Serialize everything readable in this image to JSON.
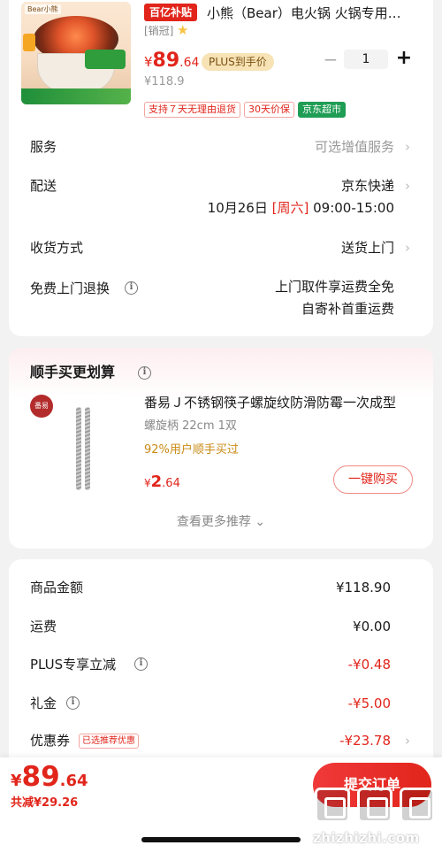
{
  "product": {
    "subsidy_tag": "百亿补贴",
    "image_brand": "Bear小熊",
    "title": "小熊（Bear）电火锅 火锅专用锅 多功能电热锅",
    "sales_rank": "[销冠]",
    "price": {
      "symbol": "¥",
      "integer": "89",
      "decimal": ".64"
    },
    "plus_badge": "PLUS到手价",
    "original_price": "¥118.9",
    "quantity": "1",
    "qty_minus": "−",
    "qty_plus": "+",
    "tags": [
      "支持７天无理由退货",
      "30天价保",
      "京东超市"
    ]
  },
  "details": {
    "service": {
      "label": "服务",
      "value": "可选增值服务"
    },
    "delivery": {
      "label": "配送",
      "value": "京东快递",
      "date": "10月26日",
      "weekday": "[周六]",
      "time": "09:00-15:00"
    },
    "receive": {
      "label": "收货方式",
      "value": "送货上门"
    },
    "free_pickup": {
      "label": "免费上门退换",
      "value_line1": "上门取件享运费全免",
      "value_line2": "自寄补首重运费"
    }
  },
  "bundle": {
    "title": "顺手买更划算",
    "item_name": "番易Ｊ不锈钢筷子螺旋纹防滑防霉一次成型",
    "spec": "螺旋柄 22cm 1双",
    "rate": "92%用户顺手买过",
    "price": {
      "symbol": "¥",
      "integer": "2",
      "decimal": ".64"
    },
    "buy_label": "一键购买",
    "more_label": "查看更多推荐 ⌄",
    "thumb_logo": "番易"
  },
  "summary": {
    "rows": [
      {
        "label": "商品金额",
        "value": "¥118.90",
        "red": false
      },
      {
        "label": "运费",
        "value": "¥0.00",
        "red": false
      },
      {
        "label": "PLUS专享立减",
        "value": "-¥0.48",
        "red": true
      },
      {
        "label": "礼金",
        "value": "-¥5.00",
        "red": true
      },
      {
        "label": "优惠券",
        "value": "-¥23.78",
        "red": true
      }
    ],
    "coupon_badge": "已选推荐优惠"
  },
  "footer": {
    "total": {
      "symbol": "¥",
      "integer": "89",
      "decimal": ".64"
    },
    "save": "共减¥29.26",
    "submit_label": "提交订单"
  },
  "watermark": {
    "text": "zhizhizhi.com"
  },
  "icons": {
    "chevron": "chevron-right-icon",
    "info": "info-icon",
    "star": "star-icon"
  },
  "colors": {
    "accent": "#e1251b",
    "plus_bg": "#f7e3b5",
    "jd_green": "#1f9d55",
    "rate": "#c98a14"
  }
}
